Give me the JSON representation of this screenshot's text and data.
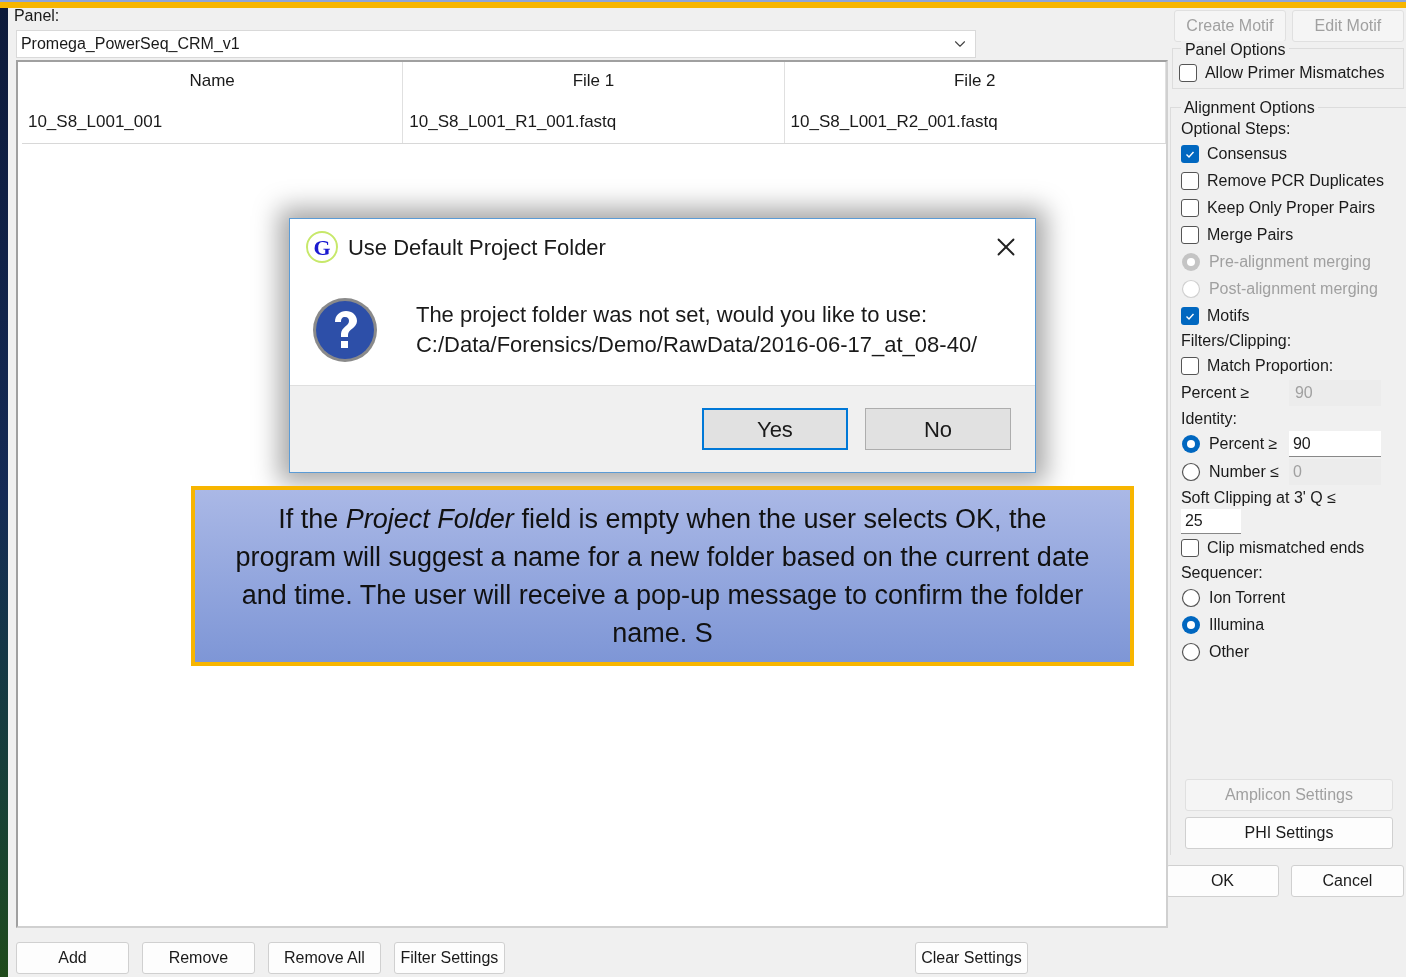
{
  "panel": {
    "label": "Panel:",
    "value": "Promega_PowerSeq_CRM_v1"
  },
  "table": {
    "columns": [
      "Name",
      "File 1",
      "File 2"
    ],
    "rows": [
      [
        "10_S8_L001_001",
        "10_S8_L001_R1_001.fastq",
        "10_S8_L001_R2_001.fastq"
      ]
    ]
  },
  "bottom_buttons": [
    {
      "label": "Add",
      "disabled": false
    },
    {
      "label": "Remove",
      "disabled": false
    },
    {
      "label": "Remove All",
      "disabled": false
    },
    {
      "label": "Filter Settings",
      "disabled": false
    },
    {
      "label": "Clear Settings",
      "disabled": false
    }
  ],
  "dialog": {
    "icon_letter": "G",
    "title": "Use Default Project Folder",
    "message": "The project folder was not set, would you like to use:",
    "path": "C:/Data/Forensics/Demo/RawData/2016-06-17_at_08-40/",
    "buttons": [
      {
        "label": "Yes",
        "default": true
      },
      {
        "label": "No",
        "default": false
      }
    ]
  },
  "callout": {
    "text": "If the *Project Folder* field is empty when the user selects OK, the program will suggest a name for a new folder based on the current date and time.  The user will receive a pop-up message to confirm the folder name. S"
  },
  "right_panel": {
    "top_buttons": [
      {
        "label": "Create Motif",
        "disabled": true
      },
      {
        "label": "Edit Motif",
        "disabled": true
      }
    ],
    "panel_options": {
      "title": "Panel Options",
      "items": [
        {
          "kind": "checkbox",
          "label": "Allow Primer Mismatches",
          "checked": false,
          "disabled": false
        }
      ]
    },
    "alignment_options": {
      "title": "Alignment Options",
      "items": [
        {
          "kind": "label",
          "text": "Optional Steps:"
        },
        {
          "kind": "checkbox",
          "label": "Consensus",
          "checked": true,
          "disabled": false
        },
        {
          "kind": "checkbox",
          "label": "Remove PCR Duplicates",
          "checked": false,
          "disabled": false
        },
        {
          "kind": "checkbox",
          "label": "Keep Only Proper Pairs",
          "checked": false,
          "disabled": false
        },
        {
          "kind": "checkbox",
          "label": "Merge Pairs",
          "checked": false,
          "disabled": false
        },
        {
          "kind": "radio",
          "label": "Pre-alignment merging",
          "selected": true,
          "disabled": true
        },
        {
          "kind": "radio",
          "label": "Post-alignment merging",
          "selected": false,
          "disabled": true
        },
        {
          "kind": "checkbox",
          "label": "Motifs",
          "checked": true,
          "disabled": false
        },
        {
          "kind": "label",
          "text": "Filters/Clipping:"
        },
        {
          "kind": "checkbox",
          "label": "Match Proportion:",
          "checked": false,
          "disabled": false
        },
        {
          "kind": "field",
          "label": "Percent ≥",
          "value": "90",
          "disabled": true
        },
        {
          "kind": "label",
          "text": "Identity:"
        },
        {
          "kind": "radio_field",
          "label": "Percent ≥",
          "selected": true,
          "value": "90",
          "disabled": false
        },
        {
          "kind": "radio_field",
          "label": "Number ≤",
          "selected": false,
          "value": "0",
          "disabled": true
        },
        {
          "kind": "label",
          "text": "Soft Clipping at 3' Q ≤"
        },
        {
          "kind": "input",
          "value": "25",
          "disabled": false
        },
        {
          "kind": "checkbox",
          "label": "Clip mismatched ends",
          "checked": false,
          "disabled": false
        },
        {
          "kind": "label",
          "text": "Sequencer:"
        },
        {
          "kind": "radio",
          "label": "Ion Torrent",
          "selected": false,
          "disabled": false
        },
        {
          "kind": "radio",
          "label": "Illumina",
          "selected": true,
          "disabled": false
        },
        {
          "kind": "radio",
          "label": "Other",
          "selected": false,
          "disabled": false
        }
      ]
    },
    "settings_buttons": [
      {
        "label": "Amplicon Settings",
        "disabled": true
      },
      {
        "label": "PHI Settings",
        "disabled": false
      }
    ],
    "dialog_buttons": [
      {
        "label": "OK",
        "disabled": false
      },
      {
        "label": "Cancel",
        "disabled": false
      }
    ]
  }
}
